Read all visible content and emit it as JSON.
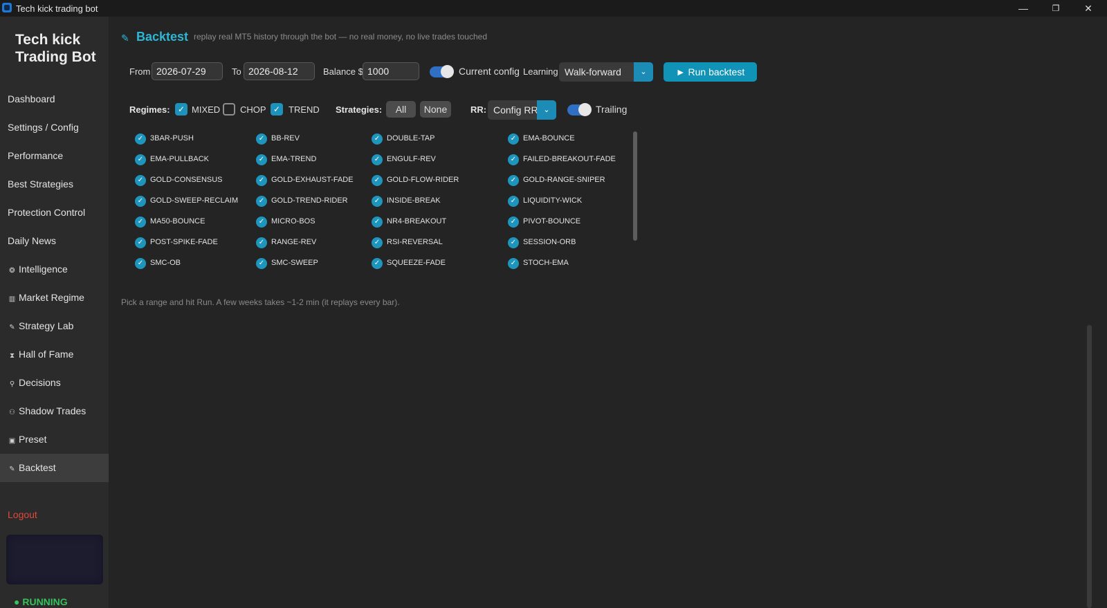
{
  "window": {
    "title": "Tech kick trading bot",
    "controls": {
      "minimize": "—",
      "restore": "❐",
      "close": "✕"
    }
  },
  "sidebar": {
    "brand": "Tech kick Trading Bot",
    "items": [
      {
        "label": "Dashboard",
        "icon": ""
      },
      {
        "label": "Settings / Config",
        "icon": ""
      },
      {
        "label": "Performance",
        "icon": ""
      },
      {
        "label": "Best Strategies",
        "icon": ""
      },
      {
        "label": "Protection Control",
        "icon": ""
      },
      {
        "label": "Daily News",
        "icon": ""
      },
      {
        "label": "Intelligence",
        "icon": "brain-icon"
      },
      {
        "label": "Market Regime",
        "icon": "chart-icon"
      },
      {
        "label": "Strategy Lab",
        "icon": "flask-icon"
      },
      {
        "label": "Hall of Fame",
        "icon": "trophy-icon"
      },
      {
        "label": "Decisions",
        "icon": "pin-icon"
      },
      {
        "label": "Shadow Trades",
        "icon": "people-icon"
      },
      {
        "label": "Preset",
        "icon": "gift-icon"
      },
      {
        "label": "Backtest",
        "icon": "flask-icon"
      }
    ],
    "active_item": "Backtest",
    "logout": "Logout",
    "status": "● RUNNING",
    "colors": {
      "logout": "#e0483c",
      "status": "#37c15a"
    }
  },
  "page": {
    "title": "Backtest",
    "icon": "flask-icon",
    "subtitle": "replay real MT5 history through the bot — no real money, no live trades touched",
    "accent": "#2eb7d5"
  },
  "controls": {
    "from_label": "From",
    "from_value": "2026-07-29",
    "to_label": "To",
    "to_value": "2026-08-12",
    "balance_label": "Balance $",
    "balance_value": "1000",
    "current_config_label": "Current config",
    "current_config_on": true,
    "learning_label": "Learning",
    "learning_value": "Walk-forward",
    "run_button": "► Run backtest",
    "run_color": "#1193b8"
  },
  "filters": {
    "regimes_label": "Regimes:",
    "regimes": [
      {
        "label": "MIXED",
        "checked": true
      },
      {
        "label": "CHOP",
        "checked": false
      },
      {
        "label": "TREND",
        "checked": true
      }
    ],
    "strategies_label": "Strategies:",
    "all_button": "All",
    "none_button": "None",
    "rr_label": "RR:",
    "rr_value": "Config RR",
    "trailing_label": "Trailing",
    "trailing_on": true
  },
  "strategies": [
    "3BAR-PUSH",
    "BB-REV",
    "DOUBLE-TAP",
    "EMA-BOUNCE",
    "EMA-PULLBACK",
    "EMA-TREND",
    "ENGULF-REV",
    "FAILED-BREAKOUT-FADE",
    "GOLD-CONSENSUS",
    "GOLD-EXHAUST-FADE",
    "GOLD-FLOW-RIDER",
    "GOLD-RANGE-SNIPER",
    "GOLD-SWEEP-RECLAIM",
    "GOLD-TREND-RIDER",
    "INSIDE-BREAK",
    "LIQUIDITY-WICK",
    "MA50-BOUNCE",
    "MICRO-BOS",
    "NR4-BREAKOUT",
    "PIVOT-BOUNCE",
    "POST-SPIKE-FADE",
    "RANGE-REV",
    "RSI-REVERSAL",
    "SESSION-ORB",
    "SMC-OB",
    "SMC-SWEEP",
    "SQUEEZE-FADE",
    "STOCH-EMA"
  ],
  "hint": "Pick a range and hit Run. A few weeks takes ~1-2 min (it replays every bar)."
}
